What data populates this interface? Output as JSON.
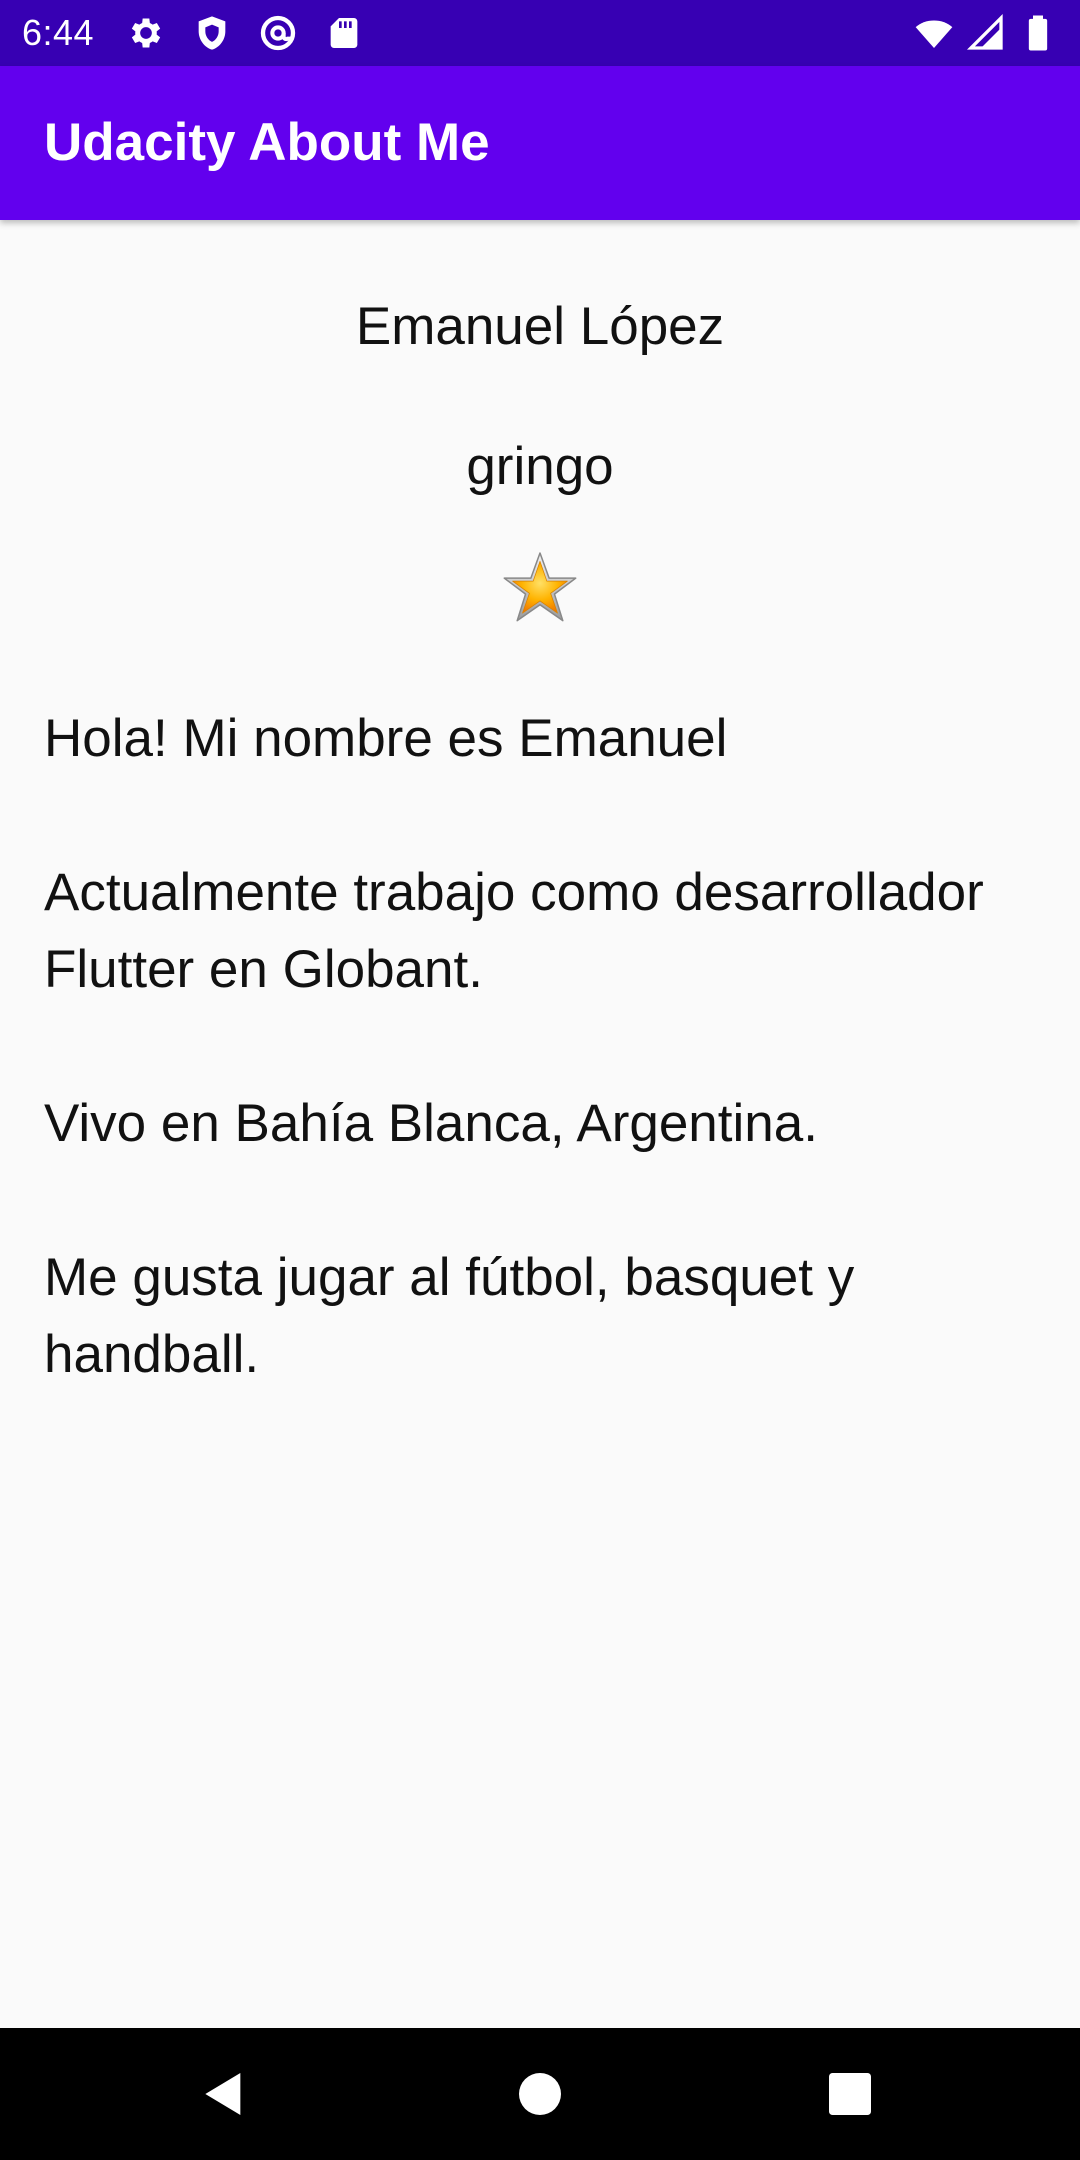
{
  "status_bar": {
    "time": "6:44",
    "left_icons": [
      "gear-icon",
      "shield-icon",
      "at-sign-icon",
      "sd-card-icon"
    ],
    "right_icons": [
      "wifi-icon",
      "cell-signal-icon",
      "battery-icon"
    ]
  },
  "app_bar": {
    "title": "Udacity About Me",
    "color": "#6200ee"
  },
  "profile": {
    "name": "Emanuel López",
    "nickname": "gringo",
    "star_icon": "star-icon"
  },
  "bio": {
    "paragraphs": [
      "Hola! Mi nombre es Emanuel",
      "Actualmente trabajo como desarrollador Flutter en Globant.",
      "Vivo en Bahía Blanca, Argentina.",
      "Me gusta jugar al fútbol, basquet y handball."
    ]
  },
  "nav_bar": {
    "buttons": [
      "back-icon",
      "home-icon",
      "recents-icon"
    ]
  }
}
